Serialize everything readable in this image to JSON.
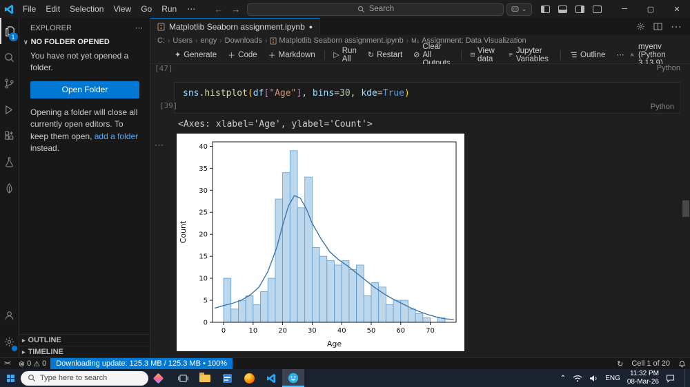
{
  "titlebar": {
    "menus": [
      "File",
      "Edit",
      "Selection",
      "View",
      "Go",
      "Run"
    ],
    "overflow": "⋯",
    "back": "←",
    "forward": "→",
    "search_label": "Search",
    "copilot_chevron": "⌄",
    "window_minimize": "─",
    "window_maximize": "▢",
    "window_close": "✕"
  },
  "activitybar": {
    "explorer_badge": "1"
  },
  "sidebar": {
    "title": "EXPLORER",
    "header_more": "⋯",
    "section_chevron": "∨",
    "section": "NO FOLDER OPENED",
    "empty_text": "You have not yet opened a folder.",
    "open_folder_label": "Open Folder",
    "note_before": "Opening a folder will close all currently open editors. To keep them open,",
    "note_link": "add a folder",
    "note_after": "instead.",
    "outline": "OUTLINE",
    "timeline": "TIMELINE",
    "collapsed_chevron": "▸"
  },
  "editor": {
    "tab_title": "Matplotlib Seaborn assignment.ipynb",
    "tab_dirty": "●",
    "tab_more": "⋯",
    "breadcrumbs": [
      "C:",
      "Users",
      "engy",
      "Downloads",
      "Matplotlib Seaborn assignment.ipynb",
      "Assignment: Data Visualization"
    ],
    "markdown_badge": "M↓",
    "toolbar": {
      "generate_icon": "✦",
      "generate": "Generate",
      "plus": "＋",
      "code": "Code",
      "markdown": "Markdown",
      "run_icon": "▷",
      "run_all": "Run All",
      "restart_icon": "↻",
      "restart": "Restart",
      "clear_icon": "⊘",
      "clear_outputs": "Clear All Outputs",
      "view_data": "View data",
      "jupyter_variables": "Jupyter Variables",
      "outline": "Outline",
      "more": "⋯",
      "kernel": "myenv (Python 3.13.9)"
    },
    "prev_exec": "[47]",
    "prev_lang": "Python",
    "cell": {
      "exec": "[39]",
      "lang": "Python",
      "tokens": [
        {
          "t": "sns",
          "s": "var"
        },
        {
          "t": ".",
          "s": "op"
        },
        {
          "t": "histplot",
          "s": "func"
        },
        {
          "t": "(",
          "s": "brack1"
        },
        {
          "t": "df",
          "s": "var"
        },
        {
          "t": "[",
          "s": "brack2"
        },
        {
          "t": "\"Age\"",
          "s": "str"
        },
        {
          "t": "]",
          "s": "brack2"
        },
        {
          "t": ", ",
          "s": "op"
        },
        {
          "t": "bins",
          "s": "var"
        },
        {
          "t": "=",
          "s": "op"
        },
        {
          "t": "30",
          "s": "num"
        },
        {
          "t": ", ",
          "s": "op"
        },
        {
          "t": "kde",
          "s": "var"
        },
        {
          "t": "=",
          "s": "op"
        },
        {
          "t": "True",
          "s": "kw"
        },
        {
          "t": ")",
          "s": "brack1"
        }
      ]
    },
    "output_repr": "<Axes: xlabel='Age', ylabel='Count'>",
    "output_menu": "⋯"
  },
  "chart_data": {
    "type": "bar",
    "subtype": "histogram_with_kde",
    "title": "",
    "xlabel": "Age",
    "ylabel": "Count",
    "xlim": [
      -3.75,
      78.75
    ],
    "ylim": [
      0,
      41
    ],
    "xticks": [
      0,
      10,
      20,
      30,
      40,
      50,
      60,
      70
    ],
    "yticks": [
      0,
      5,
      10,
      15,
      20,
      25,
      30,
      35,
      40
    ],
    "bin_start": 0,
    "bin_width": 2.5,
    "bar_values": [
      10,
      3,
      5,
      6,
      4,
      7,
      10,
      28,
      34,
      39,
      26,
      33,
      17,
      15,
      14,
      13,
      14,
      12,
      13,
      6,
      9,
      8,
      4,
      5,
      5,
      3,
      2,
      1,
      0,
      1
    ],
    "kde_points": [
      [
        -3,
        3.2
      ],
      [
        0,
        3.8
      ],
      [
        3,
        4.3
      ],
      [
        6,
        5.0
      ],
      [
        9,
        6.2
      ],
      [
        12,
        8.0
      ],
      [
        15,
        11.5
      ],
      [
        18,
        17.0
      ],
      [
        20,
        22.0
      ],
      [
        22,
        26.5
      ],
      [
        24,
        28.8
      ],
      [
        26,
        28.2
      ],
      [
        28,
        25.8
      ],
      [
        30,
        22.5
      ],
      [
        33,
        19.0
      ],
      [
        36,
        16.0
      ],
      [
        39,
        14.2
      ],
      [
        42,
        12.8
      ],
      [
        45,
        11.2
      ],
      [
        48,
        9.6
      ],
      [
        51,
        8.0
      ],
      [
        54,
        6.6
      ],
      [
        57,
        5.4
      ],
      [
        60,
        4.4
      ],
      [
        63,
        3.4
      ],
      [
        66,
        2.5
      ],
      [
        69,
        1.8
      ],
      [
        72,
        1.2
      ],
      [
        75,
        0.8
      ],
      [
        78,
        0.6
      ]
    ],
    "bar_fill": "#bdd7ec",
    "bar_edge": "#5b9bd0",
    "kde_color": "#3b76ab",
    "grid": false,
    "legend": false,
    "background": "#ffffff"
  },
  "statusbar": {
    "remote_glyph": "><",
    "errors_icon": "⊗",
    "errors": "0",
    "warnings_icon": "⚠",
    "warnings": "0",
    "download": "Downloading update: 125.3 MB / 125.3 MB • 100%",
    "sync_icon": "↻",
    "cell_indicator": "Cell 1 of 20"
  },
  "taskbar": {
    "search_placeholder": "Type here to search",
    "language": "ENG",
    "time": "11:32 PM",
    "date": "08-Mar-26",
    "tray_chevron": "⌃"
  }
}
